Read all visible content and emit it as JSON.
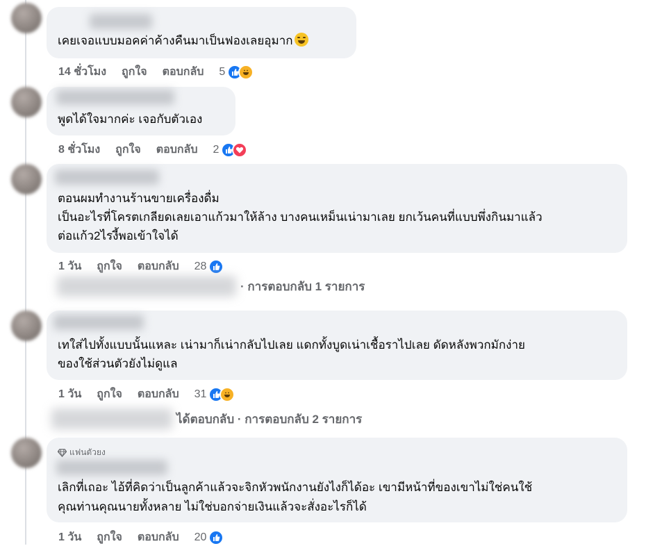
{
  "comments": [
    {
      "text_lines": [
        "เคยเจอแบบมอคค่าค้างคืนมาเป็นฟองเลยอุมาก"
      ],
      "emoji": "weary-face-emoji",
      "time": "14 ชั่วโมง",
      "like_label": "ถูกใจ",
      "reply_label": "ตอบกลับ",
      "reaction_count": "5",
      "reactions": [
        "like",
        "haha"
      ]
    },
    {
      "text_lines": [
        "พูดได้ใจมากค่ะ เจอกับตัวเอง"
      ],
      "time": "8 ชั่วโมง",
      "like_label": "ถูกใจ",
      "reply_label": "ตอบกลับ",
      "reaction_count": "2",
      "reactions": [
        "like",
        "love"
      ]
    },
    {
      "text_lines": [
        "ตอนผมทำงานร้านขายเครื่องดื่ม",
        "เป็นอะไรที่โครตเกลียดเลยเอาแก้วมาให้ล้าง บางคนเหม็นเน่ามาเลย ยกเว้นคนที่แบบพึ่งกินมาแล้ว",
        "ต่อแก้ว2ไรงี้พอเข้าใจได้"
      ],
      "time": "1 วัน",
      "like_label": "ถูกใจ",
      "reply_label": "ตอบกลับ",
      "reaction_count": "28",
      "reactions": [
        "like"
      ],
      "replies_text": "· การตอบกลับ 1 รายการ"
    },
    {
      "text_lines": [
        "เทใส่ไปทั้งแบบนั้นแหละ เน่ามาก็เน่ากลับไปเลย แดกทั้งบูดเน่าเชื้อราไปเลย ดัดหลังพวกมักง่าย",
        "ของใช้ส่วนตัวยังไม่ดูแล"
      ],
      "time": "1 วัน",
      "like_label": "ถูกใจ",
      "reply_label": "ตอบกลับ",
      "reaction_count": "31",
      "reactions": [
        "like",
        "haha"
      ],
      "replies_text": "ได้ตอบกลับ · การตอบกลับ 2 รายการ"
    },
    {
      "badge": "แฟนตัวยง",
      "text_lines": [
        "เลิกที่เถอะ ไอ้ที่คิดว่าเป็นลูกค้าแล้วจะจิกหัวพนักงานยังไงก็ได้อะ เขามีหน้าที่ของเขาไม่ใช่คนใช้",
        "คุณท่านคุณนายทั้งหลาย ไม่ใช่บอกจ่ายเงินแล้วจะสั่งอะไรก็ได้"
      ],
      "time": "1 วัน",
      "like_label": "ถูกใจ",
      "reply_label": "ตอบกลับ",
      "reaction_count": "20",
      "reactions": [
        "like"
      ]
    }
  ]
}
